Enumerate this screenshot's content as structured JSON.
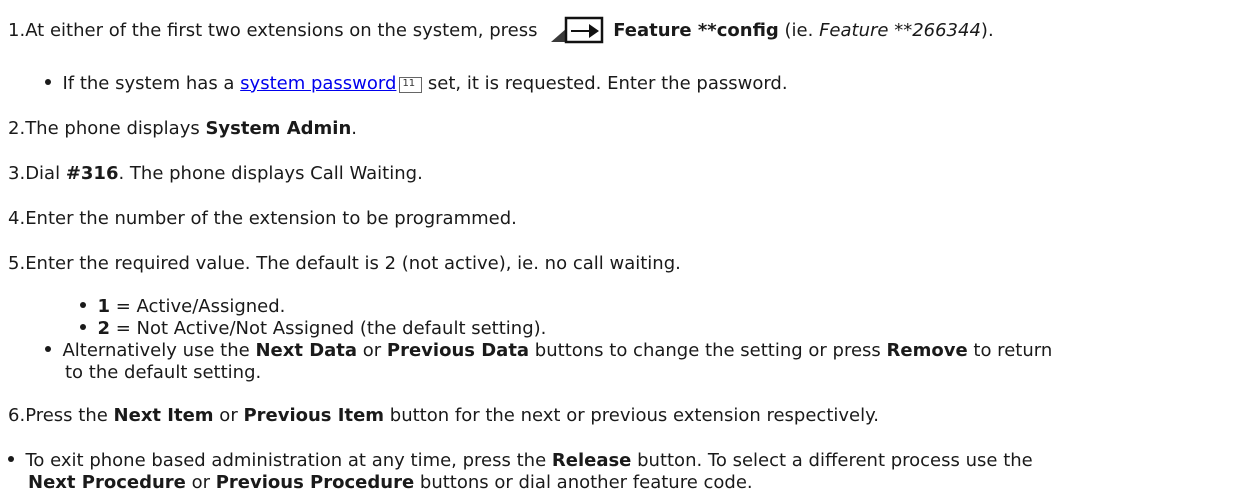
{
  "step1": {
    "num": "1.",
    "pre": "At either of the first two extensions on the system, press ",
    "bold": "Feature **config",
    "mid": " (ie. ",
    "italic": "Feature **266344",
    "post": ")."
  },
  "step1_sub": {
    "pre": "If the system has a ",
    "link": "system password",
    "ref": "11",
    "post": " set, it is requested. Enter the password."
  },
  "step2": {
    "num": "2.",
    "pre": "The phone displays ",
    "bold": "System Admin",
    "post": "."
  },
  "step3": {
    "num": "3.",
    "pre": "Dial ",
    "bold": "#316",
    "post": ". The phone displays Call Waiting."
  },
  "step4": {
    "num": "4.",
    "text": "Enter the number of the extension to be programmed."
  },
  "step5": {
    "num": "5.",
    "text": "Enter the required value. The default is 2 (not active), ie. no call waiting."
  },
  "step5_opt1": {
    "bold": "1",
    "text": " = Active/Assigned."
  },
  "step5_opt2": {
    "bold": "2",
    "text": " = Not Active/Not Assigned (the default setting)."
  },
  "step5_alt": {
    "pre": "Alternatively use the ",
    "bold1": "Next Data",
    "mid1": " or ",
    "bold2": "Previous Data",
    "mid2": " buttons to change the setting or press ",
    "bold3": "Remove",
    "post": " to return",
    "line2": "to the default setting."
  },
  "step6": {
    "num": "6.",
    "pre": "Press the ",
    "bold1": "Next Item",
    "mid": " or ",
    "bold2": "Previous Item",
    "post": " button for the next or previous extension respectively."
  },
  "exit_note": {
    "pre": "To exit phone based administration at any time, press the ",
    "bold1": "Release",
    "mid": " button. To select a different process use the",
    "bold2": "Next Procedure",
    "mid2": " or ",
    "bold3": "Previous Procedure",
    "post": " buttons or dial another feature code."
  }
}
